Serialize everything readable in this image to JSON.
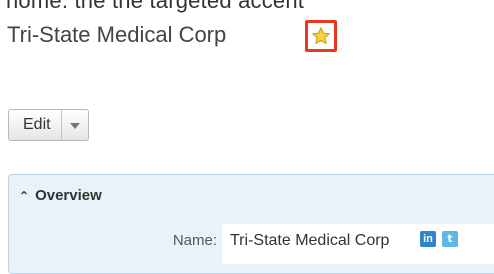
{
  "header": {
    "cropped_text": "home. the the targeted accent",
    "record_name": "Tri-State Medical Corp"
  },
  "actions": {
    "edit_label": "Edit"
  },
  "panel": {
    "title": "Overview",
    "fields": [
      {
        "label": "Name:",
        "value": "Tri-State Medical Corp"
      }
    ]
  },
  "colors": {
    "highlight_border": "#e8381e",
    "star_fill": "#f7d23e",
    "panel_bg": "#e9f2f8",
    "linkedin": "#2c87c6",
    "twitter": "#5fb6e8"
  },
  "icons": {
    "favorite": "star-icon",
    "dropdown": "caret-down-icon",
    "collapse": "double-chevron-up-icon",
    "linkedin": "linkedin-icon",
    "twitter": "twitter-icon"
  }
}
